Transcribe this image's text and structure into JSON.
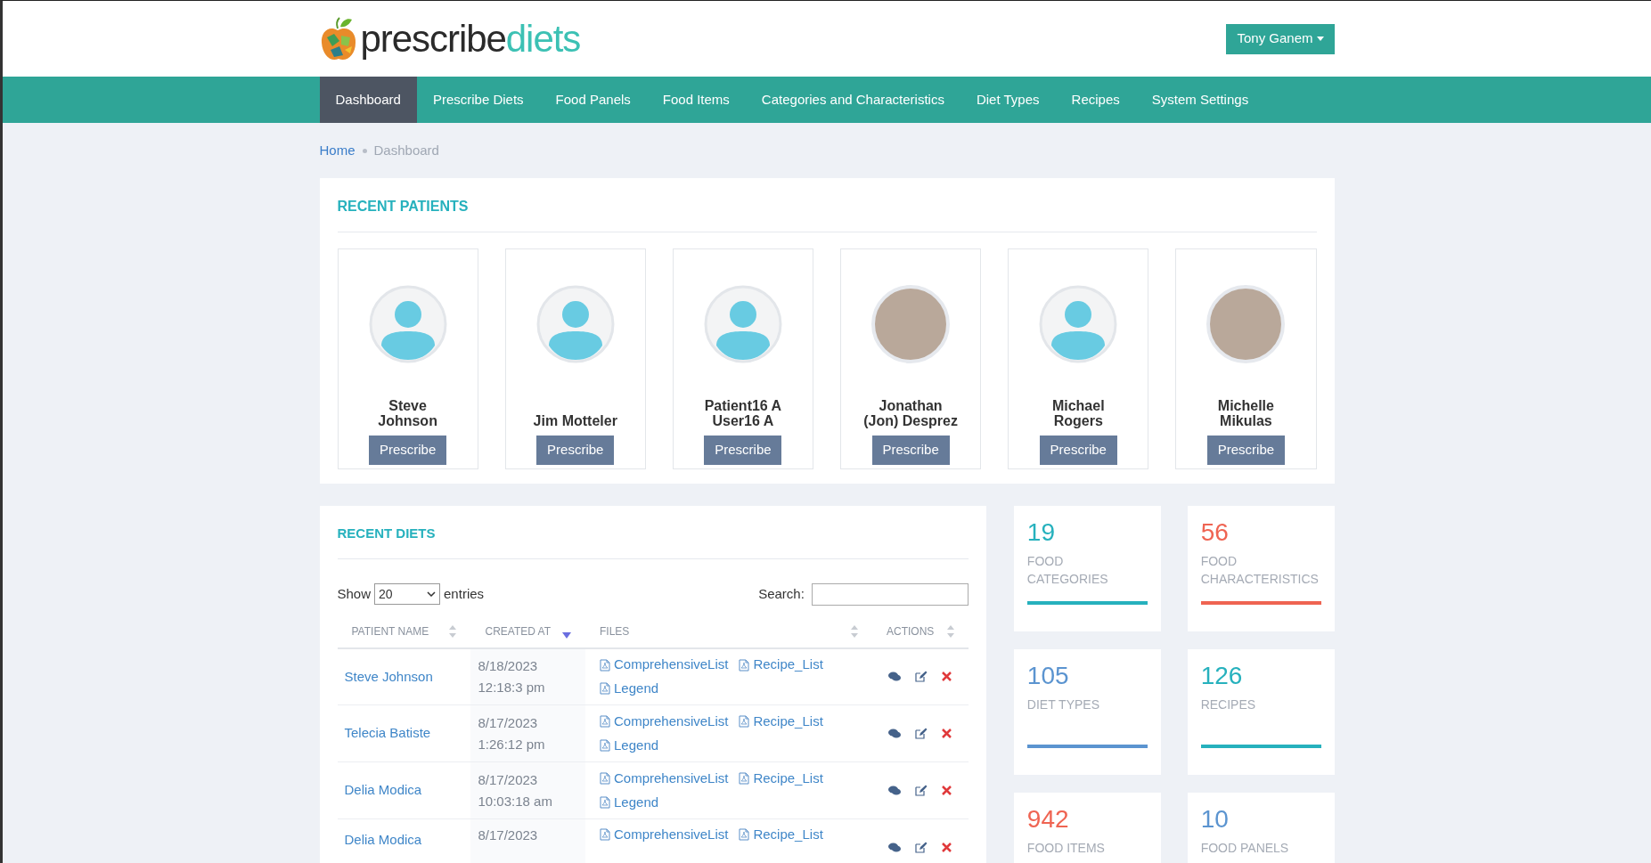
{
  "logo": {
    "dark_part": "prescribe",
    "accent_part": "diets"
  },
  "user_menu": {
    "label": "Tony Ganem"
  },
  "nav": [
    {
      "label": "Dashboard",
      "selected": true
    },
    {
      "label": "Prescribe Diets",
      "selected": false
    },
    {
      "label": "Food Panels",
      "selected": false
    },
    {
      "label": "Food Items",
      "selected": false
    },
    {
      "label": "Categories and Characteristics",
      "selected": false
    },
    {
      "label": "Diet Types",
      "selected": false
    },
    {
      "label": "Recipes",
      "selected": false
    },
    {
      "label": "System Settings",
      "selected": false
    }
  ],
  "breadcrumb": [
    {
      "label": "Home",
      "selected": false
    },
    {
      "label": "Dashboard",
      "selected": true
    }
  ],
  "recent_patients": {
    "title": "RECENT PATIENTS",
    "patients": [
      {
        "name": "Steve Johnson",
        "kind": "placeholder",
        "button": "Prescribe"
      },
      {
        "name": "Jim Motteler",
        "kind": "placeholder",
        "button": "Prescribe"
      },
      {
        "name": "Patient16 A User16 A",
        "kind": "placeholder",
        "button": "Prescribe"
      },
      {
        "name": "Jonathan (Jon) Desprez",
        "kind": "photo",
        "button": "Prescribe"
      },
      {
        "name": "Michael Rogers",
        "kind": "placeholder",
        "button": "Prescribe"
      },
      {
        "name": "Michelle Mikulas",
        "kind": "photo",
        "button": "Prescribe"
      }
    ]
  },
  "recent_diets": {
    "title": "RECENT DIETS",
    "show_label": "Show",
    "page_size": "20",
    "entries_label": "entries",
    "search_label": "Search:",
    "columns": [
      {
        "label": "PATIENT NAME",
        "sorted": false
      },
      {
        "label": "CREATED AT",
        "sorted": true
      },
      {
        "label": "FILES",
        "sorted": false
      },
      {
        "label": "ACTIONS",
        "sorted": false
      }
    ],
    "rows": [
      {
        "patient": "Steve Johnson",
        "date": "8/18/2023",
        "time": "12:18:3 pm",
        "files": [
          "ComprehensiveList",
          "Recipe_List",
          "Legend"
        ]
      },
      {
        "patient": "Telecia Batiste",
        "date": "8/17/2023",
        "time": "1:26:12 pm",
        "files": [
          "ComprehensiveList",
          "Recipe_List",
          "Legend"
        ]
      },
      {
        "patient": "Delia Modica",
        "date": "8/17/2023",
        "time": "10:03:18 am",
        "files": [
          "ComprehensiveList",
          "Recipe_List",
          "Legend"
        ]
      },
      {
        "patient": "Delia Modica",
        "date": "8/17/2023",
        "files": [
          "ComprehensiveList",
          "Recipe_List"
        ]
      }
    ]
  },
  "stats": [
    {
      "value": "19",
      "label": "FOOD CATEGORIES",
      "color": "#26b1bd"
    },
    {
      "value": "56",
      "label": "FOOD CHARACTERISTICS",
      "color": "#ef6452"
    },
    {
      "value": "105",
      "label": "DIET TYPES",
      "color": "#5b94d0"
    },
    {
      "value": "126",
      "label": "RECIPES",
      "color": "#26b1bd"
    },
    {
      "value": "942",
      "label": "FOOD ITEMS",
      "color": "#ef6452"
    },
    {
      "value": "10",
      "label": "FOOD PANELS",
      "color": "#5b94d0"
    }
  ]
}
